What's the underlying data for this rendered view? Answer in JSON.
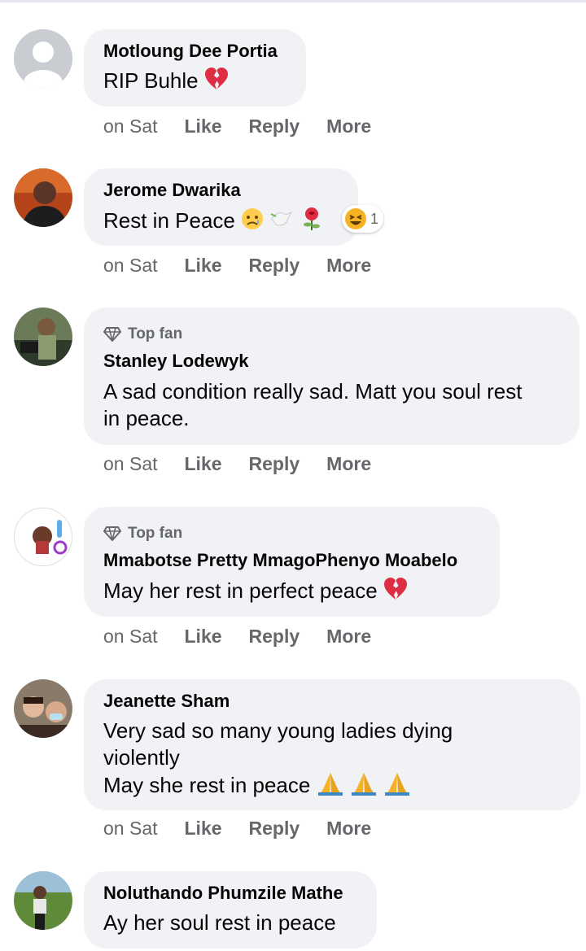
{
  "comments": [
    {
      "author": "Motloung Dee Portia",
      "text": "RIP Buhle",
      "time": "on Sat",
      "like": "Like",
      "reply": "Reply",
      "more": "More"
    },
    {
      "author": "Jerome Dwarika",
      "text": "Rest in Peace",
      "time": "on Sat",
      "like": "Like",
      "reply": "Reply",
      "more": "More",
      "reaction_count": "1"
    },
    {
      "badge": "Top fan",
      "author": "Stanley Lodewyk",
      "text": "A sad condition really sad. Matt you soul rest in peace.",
      "time": "on Sat",
      "like": "Like",
      "reply": "Reply",
      "more": "More"
    },
    {
      "badge": "Top fan",
      "author": "Mmabotse Pretty MmagoPhenyo Moabelo",
      "text": "May her rest in perfect peace",
      "time": "on Sat",
      "like": "Like",
      "reply": "Reply",
      "more": "More"
    },
    {
      "author": "Jeanette Sham",
      "text_line1": "Very sad so many young ladies dying violently",
      "text_line2": "May she rest in peace",
      "time": "on Sat",
      "like": "Like",
      "reply": "Reply",
      "more": "More"
    },
    {
      "author": "Noluthando Phumzile Mathe",
      "text": "Ay her soul rest in peace"
    }
  ],
  "icons": {
    "broken_heart": "broken-heart-emoji",
    "sad_face": "sad-face-emoji",
    "dove": "dove-emoji",
    "rose": "rose-emoji",
    "haha": "haha-reaction-icon",
    "pray": "folded-hands-emoji",
    "diamond": "top-fan-diamond-icon"
  },
  "colors": {
    "bubble": "#f0f2f5",
    "meta_text": "#65676b",
    "text": "#050505"
  }
}
